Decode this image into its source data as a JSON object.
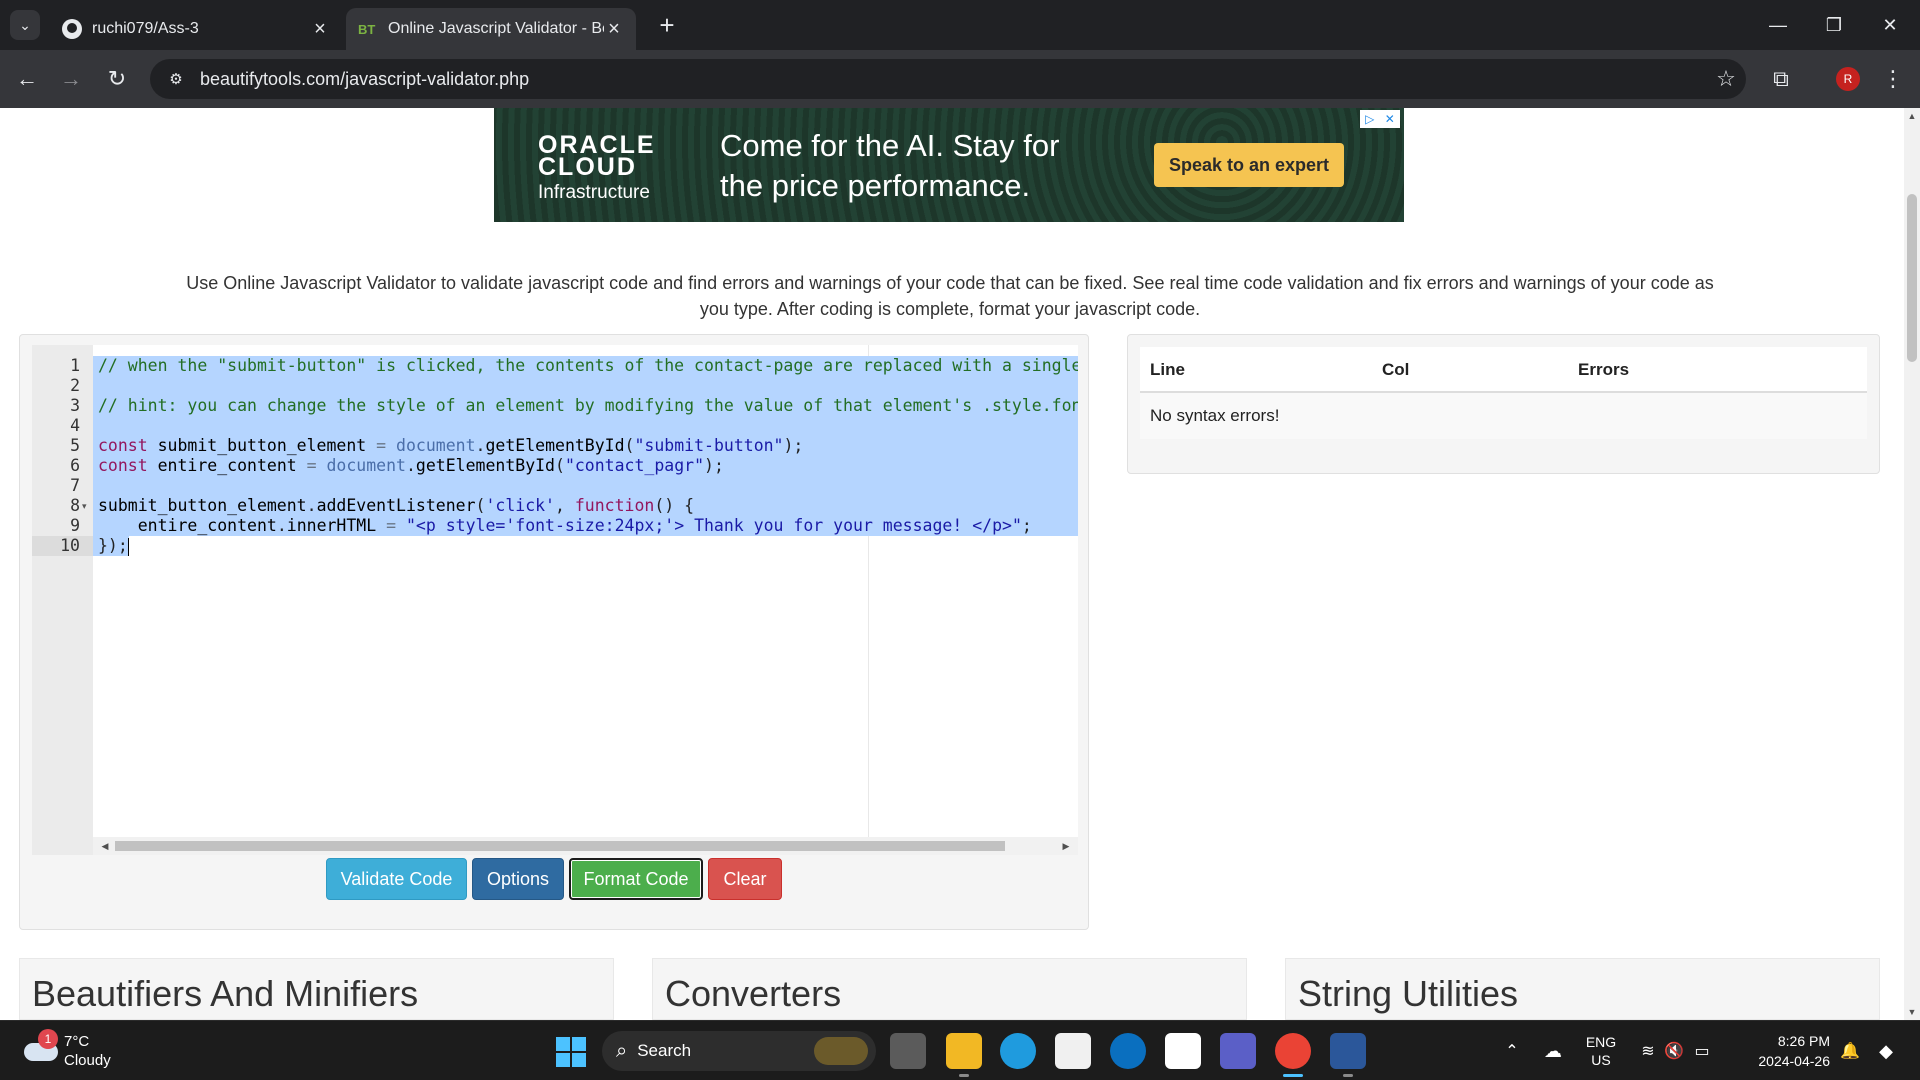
{
  "browser": {
    "tabs": [
      {
        "title": "ruchi079/Ass-3",
        "icon": "github-icon"
      },
      {
        "title": "Online Javascript Validator - Be",
        "icon": "beautifytools-icon"
      }
    ],
    "new_tab": "+",
    "url": "beautifytools.com/javascript-validator.php",
    "profile_initial": "R"
  },
  "ad": {
    "logo_line1": "ORACLE",
    "logo_line2": "CLOUD",
    "logo_line3": "Infrastructure",
    "headline": "Come for the AI. Stay for the price performance.",
    "cta": "Speak to an expert"
  },
  "description": "Use Online Javascript Validator to validate javascript code and find errors and warnings of your code that can be fixed. See real time code validation and fix errors and warnings of your code as you type. After coding is complete, format your javascript code.",
  "editor": {
    "line_numbers": [
      "1",
      "2",
      "3",
      "4",
      "5",
      "6",
      "7",
      "8",
      "9",
      "10"
    ],
    "active_line": "10",
    "lines": [
      "// when the \"submit-button\" is clicked, the contents of the contact-page are replaced with a single <p",
      "",
      "// hint: you can change the style of an element by modifying the value of that element's .style.fontSi",
      "",
      "const submit_button_element = document.getElementById(\"submit-button\");",
      "const entire_content = document.getElementById(\"contact_pagr\");",
      "",
      "submit_button_element.addEventListener('click', function() {",
      "    entire_content.innerHTML = \"<p style='font-size:24px;'> Thank you for your message! </p>\";",
      "});"
    ]
  },
  "buttons": {
    "validate": "Validate Code",
    "options": "Options",
    "format": "Format Code",
    "clear": "Clear"
  },
  "results": {
    "col_line": "Line",
    "col_col": "Col",
    "col_errors": "Errors",
    "message": "No syntax errors!"
  },
  "sections": [
    "Beautifiers And Minifiers",
    "Converters",
    "String Utilities"
  ],
  "taskbar": {
    "weather_badge": "1",
    "temperature": "7°C",
    "condition": "Cloudy",
    "search_label": "Search",
    "language": "ENG",
    "region": "US",
    "time": "8:26 PM",
    "date": "2024-04-26"
  },
  "colors": {
    "validate": "#3eaed8",
    "options": "#2f6ba1",
    "format": "#4cae4c",
    "clear": "#d9534f",
    "selection": "#b5d5ff"
  }
}
